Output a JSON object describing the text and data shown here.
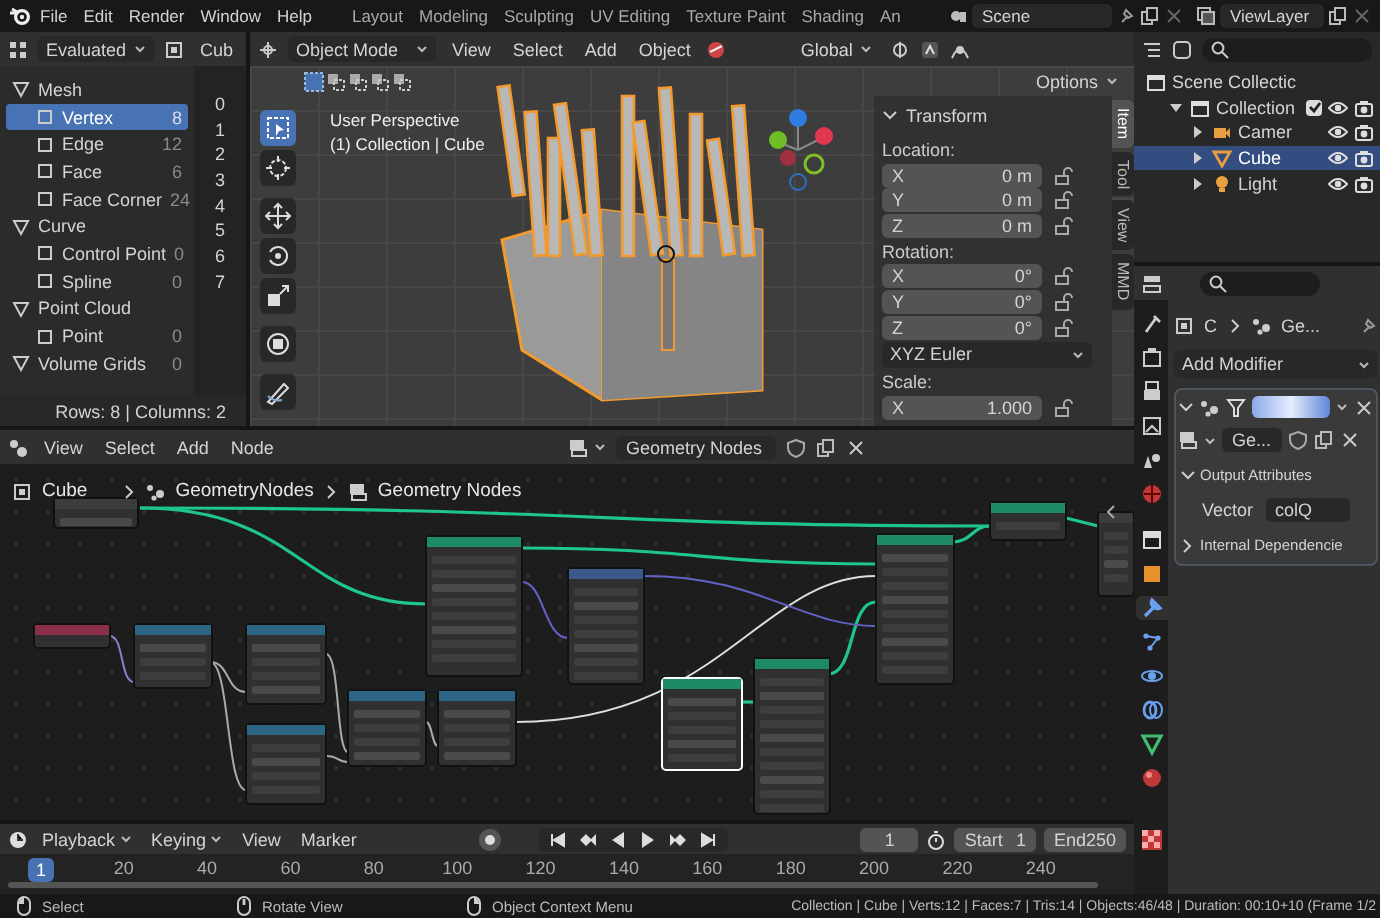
{
  "topbar": {
    "menus": [
      "File",
      "Edit",
      "Render",
      "Window",
      "Help"
    ],
    "workspaces": [
      {
        "label": "Layout",
        "selected": false
      },
      {
        "label": "Modeling",
        "selected": false
      },
      {
        "label": "Sculpting",
        "selected": false
      },
      {
        "label": "UV Editing",
        "selected": false
      },
      {
        "label": "Texture Paint",
        "selected": false
      },
      {
        "label": "Shading",
        "selected": false
      },
      {
        "label": "An",
        "selected": false
      }
    ],
    "scene": "Scene",
    "view_layer": "ViewLayer"
  },
  "spreadsheet": {
    "mode": "Evaluated",
    "object": "Cub",
    "items": [
      {
        "label": "Mesh",
        "selected": false,
        "children": [
          {
            "label": "Vertex",
            "count": "8",
            "selected": true
          },
          {
            "label": "Edge",
            "count": "12",
            "selected": false
          },
          {
            "label": "Face",
            "count": "6",
            "selected": false
          },
          {
            "label": "Face Corner",
            "count": "24",
            "selected": false
          }
        ]
      },
      {
        "label": "Curve",
        "selected": false,
        "children": [
          {
            "label": "Control Point",
            "count": "0",
            "selected": false
          },
          {
            "label": "Spline",
            "count": "0",
            "selected": false
          }
        ]
      },
      {
        "label": "Point Cloud",
        "selected": false,
        "children": [
          {
            "label": "Point",
            "count": "0",
            "selected": false
          }
        ]
      },
      {
        "label": "Volume Grids",
        "count": "0",
        "selected": false
      }
    ],
    "row_numbers": [
      "0",
      "1",
      "2",
      "3",
      "4",
      "5",
      "6",
      "7"
    ],
    "footer": "Rows: 8 | Columns: 2"
  },
  "viewport": {
    "mode": "Object Mode",
    "menus": [
      "View",
      "Select",
      "Add",
      "Object"
    ],
    "orientation": "Global",
    "options": "Options",
    "overlay": [
      "User Perspective",
      "(1) Collection | Cube"
    ],
    "tools": [
      {
        "kind": "select",
        "selected": true
      },
      {
        "kind": "cursor",
        "selected": false
      },
      {
        "kind": "move",
        "selected": false
      },
      {
        "kind": "rotate",
        "selected": false
      },
      {
        "kind": "scale",
        "selected": false
      },
      {
        "kind": "transform",
        "selected": false
      },
      {
        "kind": "annotate",
        "selected": false
      }
    ],
    "sidebar": {
      "title": "Transform",
      "sections": [
        {
          "kind": "fields",
          "label": "Location:",
          "fields": [
            {
              "axis": "X",
              "value": "0 m"
            },
            {
              "axis": "Y",
              "value": "0 m"
            },
            {
              "axis": "Z",
              "value": "0 m"
            }
          ]
        },
        {
          "kind": "fields",
          "label": "Rotation:",
          "fields": [
            {
              "axis": "X",
              "value": "0°"
            },
            {
              "axis": "Y",
              "value": "0°"
            },
            {
              "axis": "Z",
              "value": "0°"
            }
          ]
        },
        {
          "kind": "dropdown",
          "value": "XYZ Euler"
        },
        {
          "kind": "fields",
          "label": "Scale:",
          "fields": [
            {
              "axis": "X",
              "value": "1.000"
            }
          ]
        }
      ]
    },
    "tabs": [
      {
        "label": "Item",
        "selected": true
      },
      {
        "label": "Tool",
        "selected": false
      },
      {
        "label": "View",
        "selected": false
      },
      {
        "label": "MMD",
        "selected": false
      }
    ]
  },
  "outliner": {
    "tree": [
      {
        "label": "Scene Collectic",
        "kind": "scene",
        "selected": false,
        "children": [
          {
            "label": "Collection",
            "kind": "collection",
            "expanded": true,
            "checked": true,
            "selected": false,
            "children": [
              {
                "label": "Camer",
                "kind": "camera",
                "expanded": false,
                "selected": false
              },
              {
                "label": "Cube",
                "kind": "mesh",
                "expanded": false,
                "selected": true
              },
              {
                "label": "Light",
                "kind": "light",
                "expanded": false,
                "selected": false
              }
            ]
          }
        ]
      }
    ]
  },
  "properties": {
    "tabs": [
      {
        "kind": "tool",
        "selected": false
      },
      {
        "kind": "render",
        "selected": false
      },
      {
        "kind": "output",
        "selected": false
      },
      {
        "kind": "view_layer",
        "selected": false
      },
      {
        "kind": "scene",
        "selected": false
      },
      {
        "kind": "world",
        "selected": false
      },
      {
        "kind": "collection",
        "selected": false
      },
      {
        "kind": "object",
        "selected": false
      },
      {
        "kind": "modifiers",
        "selected": true
      },
      {
        "kind": "particles",
        "selected": false
      },
      {
        "kind": "physics",
        "selected": false
      },
      {
        "kind": "constraints",
        "selected": false
      },
      {
        "kind": "data",
        "selected": false
      },
      {
        "kind": "material",
        "selected": false
      },
      {
        "kind": "texture",
        "selected": false
      }
    ],
    "breadcrumb": [
      "C",
      "Ge..."
    ],
    "add_modifier": "Add Modifier",
    "modifier": {
      "expanded": true,
      "node_group": "Ge...",
      "sections": [
        {
          "label": "Output Attributes",
          "expanded": true,
          "fields": [
            {
              "label": "Vector",
              "value": "colQ"
            }
          ]
        },
        {
          "label": "Internal Dependencie",
          "expanded": false
        }
      ]
    }
  },
  "node_editor": {
    "menus": [
      "View",
      "Select",
      "Add",
      "Node"
    ],
    "node_group": "Geometry Nodes",
    "breadcrumbs": [
      "Cube",
      "GeometryNodes",
      "Geometry Nodes"
    ]
  },
  "timeline": {
    "menus": [
      "Playback",
      "Keying",
      "View",
      "Marker"
    ],
    "frame": "1",
    "start_label": "Start",
    "start": "1",
    "end_label": "End",
    "end": "250",
    "playhead": "1",
    "ruler": [
      "20",
      "40",
      "60",
      "80",
      "100",
      "120",
      "140",
      "160",
      "180",
      "200",
      "220",
      "240"
    ]
  },
  "status_bar": {
    "hints": [
      {
        "kind": "left_click",
        "label": "Select"
      },
      {
        "kind": "middle_click",
        "label": "Rotate View"
      },
      {
        "kind": "right_click",
        "label": "Object Context Menu"
      }
    ],
    "stats": "Collection | Cube | Verts:12 | Faces:7 | Tris:14 | Objects:46/48 | Duration: 00:10+10 (Frame 1/2"
  }
}
